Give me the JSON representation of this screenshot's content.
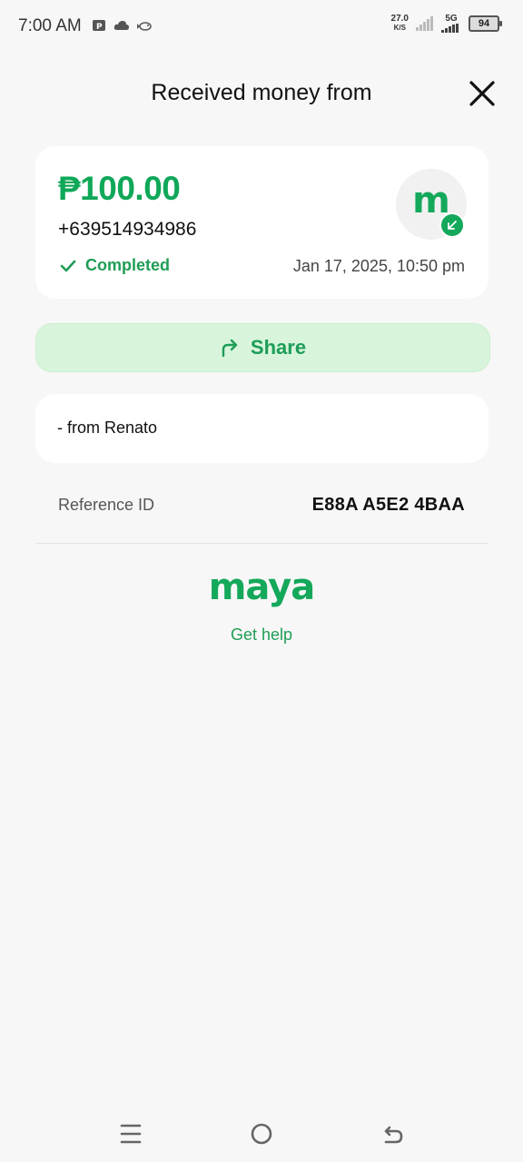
{
  "status_bar": {
    "time": "7:00 AM",
    "net_speed": "27.0",
    "net_unit": "K/S",
    "network": "5G",
    "battery": "94"
  },
  "header": {
    "title": "Received money from"
  },
  "transaction": {
    "amount": "₱100.00",
    "sender_phone": "+639514934986",
    "status": "Completed",
    "datetime": "Jan 17, 2025, 10:50 pm",
    "avatar_letter": "m"
  },
  "share": {
    "label": "Share"
  },
  "note": {
    "text": "- from Renato"
  },
  "reference": {
    "label": "Reference ID",
    "value": "E88A A5E2 4BAA"
  },
  "brand": {
    "logo_text": "maya",
    "accent_color": "#14a85b"
  },
  "help": {
    "label": "Get help"
  }
}
